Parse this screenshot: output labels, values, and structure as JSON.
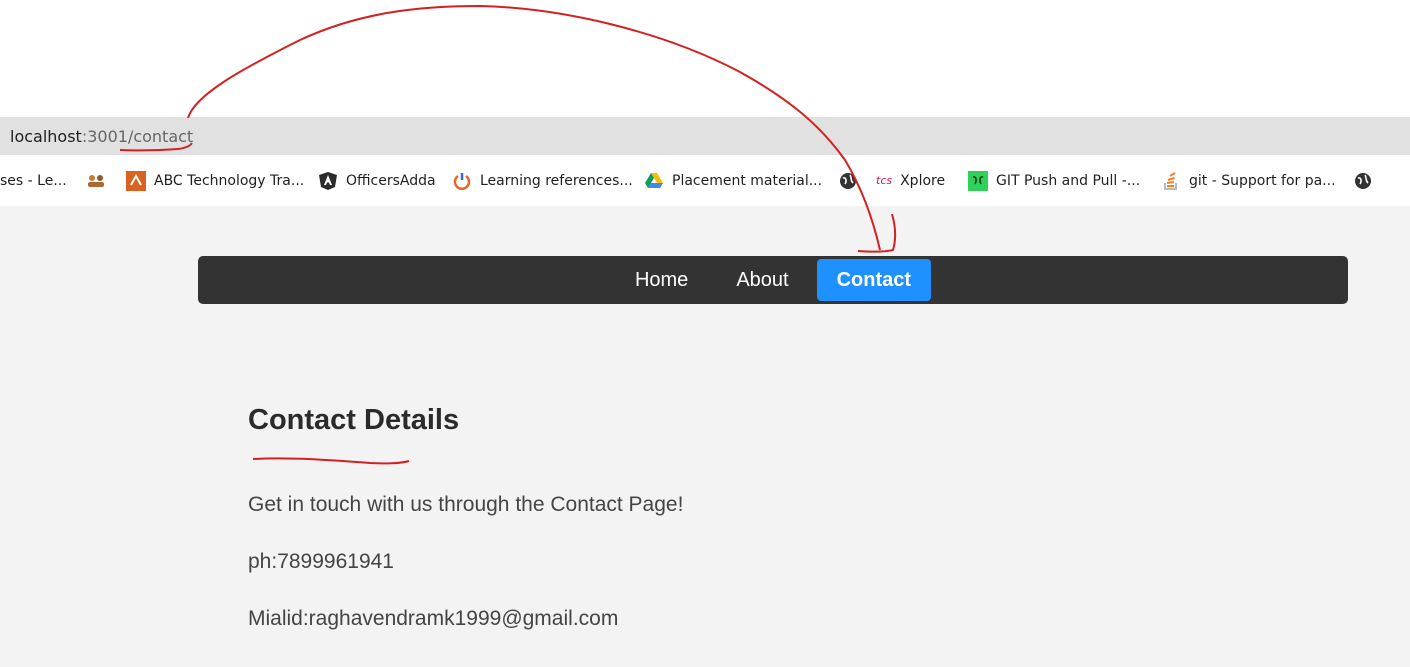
{
  "browser": {
    "address": {
      "host": "localhost",
      "path": ":3001/contact"
    },
    "bookmarks": [
      {
        "label": "ses - Le...",
        "icon": "partial-tab"
      },
      {
        "label": "",
        "icon": "users-icon"
      },
      {
        "label": "ABC Technology Tra...",
        "icon": "abc-logo-icon"
      },
      {
        "label": "OfficersAdda",
        "icon": "angular-icon"
      },
      {
        "label": "Learning references...",
        "icon": "power-icon"
      },
      {
        "label": "Placement material...",
        "icon": "google-drive-icon"
      },
      {
        "label": "",
        "icon": "globe-icon"
      },
      {
        "label": "Xplore",
        "icon": "tcs-logo-icon",
        "icon_text": "tcs"
      },
      {
        "label": "GIT Push and Pull -...",
        "icon": "geeks-icon"
      },
      {
        "label": "git - Support for pa...",
        "icon": "stackoverflow-icon"
      },
      {
        "label": "",
        "icon": "globe-icon"
      }
    ]
  },
  "nav": {
    "items": [
      {
        "label": "Home",
        "active": false
      },
      {
        "label": "About",
        "active": false
      },
      {
        "label": "Contact",
        "active": true
      }
    ]
  },
  "contact": {
    "title": "Contact Details",
    "message": "Get in touch with us through the Contact Page!",
    "phone": "ph:7899961941",
    "email": "Mialid:raghavendramk1999@gmail.com"
  },
  "colors": {
    "navbar_bg": "#333333",
    "active_link": "#1e90ff",
    "page_bg": "#f3f3f3",
    "annotation": "#d42020"
  }
}
